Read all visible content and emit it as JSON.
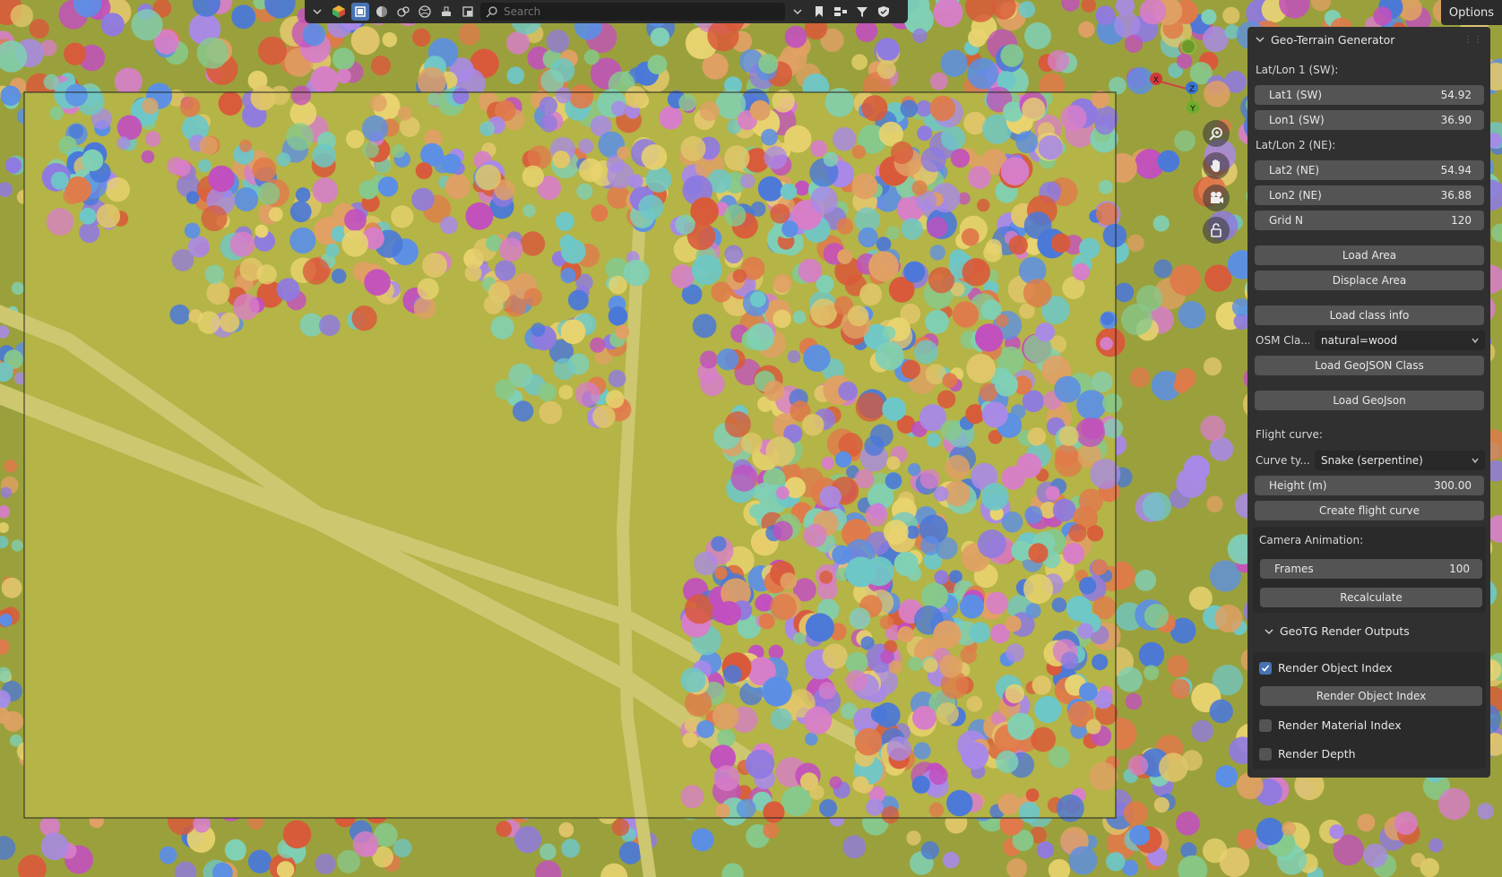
{
  "toolbar": {
    "search_placeholder": "Search",
    "options_label": "Options"
  },
  "gizmo": {
    "x_label": "X",
    "y_label": "Y",
    "z_label": "Z"
  },
  "panel": {
    "title": "Geo-Terrain Generator",
    "sw_section": "Lat/Lon 1 (SW):",
    "lat1_label": "Lat1 (SW)",
    "lat1_value": "54.92",
    "lon1_label": "Lon1 (SW)",
    "lon1_value": "36.90",
    "ne_section": "Lat/Lon 2 (NE):",
    "lat2_label": "Lat2 (NE)",
    "lat2_value": "54.94",
    "lon2_label": "Lon2 (NE)",
    "lon2_value": "36.88",
    "grid_label": "Grid N",
    "grid_value": "120",
    "load_area": "Load Area",
    "displace_area": "Displace Area",
    "load_class_info": "Load class info",
    "osm_class_label": "OSM Cla...",
    "osm_class_value": "natural=wood",
    "load_geojson_class": "Load GeoJSON Class",
    "load_geojson": "Load GeoJson",
    "flight_section": "Flight curve:",
    "curve_type_label": "Curve ty...",
    "curve_type_value": "Snake (serpentine)",
    "height_label": "Height (m)",
    "height_value": "300.00",
    "create_flight_curve": "Create flight curve",
    "camera_section": "Camera Animation:",
    "frames_label": "Frames",
    "frames_value": "100",
    "recalculate": "Recalculate",
    "render_outputs_title": "GeoTG Render Outputs",
    "render_object_index_check": "Render Object Index",
    "render_object_index_checked": true,
    "render_object_index_button": "Render Object Index",
    "render_material_index": "Render Material Index",
    "render_material_index_checked": false,
    "render_depth": "Render Depth",
    "render_depth_checked": false
  },
  "colors": {
    "viewport_bg": "#9aa13c",
    "ground": "#b4b447",
    "road": "#cdc770",
    "panel_bg": "#303030",
    "field_bg": "#545454",
    "accent": "#4772b3"
  },
  "icons": [
    "search-icon",
    "zoom-icon",
    "hand-icon",
    "camera-icon",
    "lock-icon",
    "chevron-down-icon",
    "checkbox-icon",
    "filter-icon",
    "bookmark-icon",
    "shield-icon"
  ]
}
